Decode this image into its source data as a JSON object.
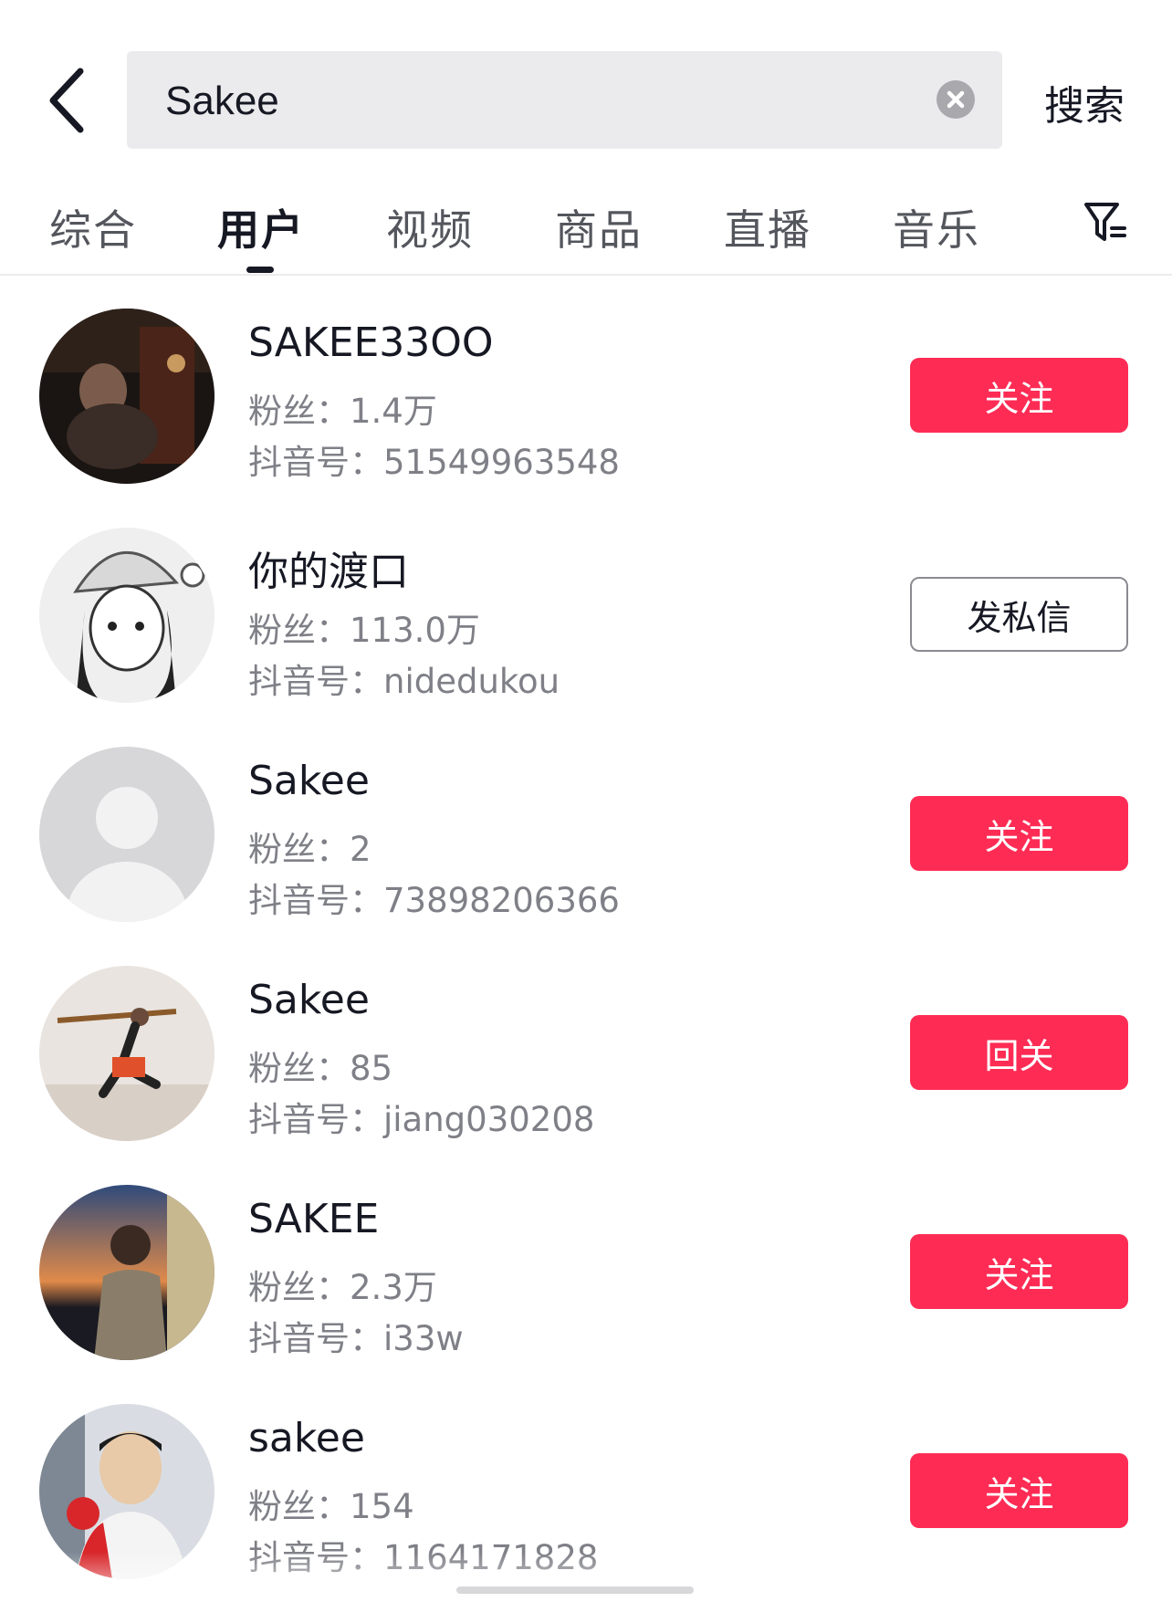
{
  "search": {
    "query": "Sakee",
    "button_label": "搜索"
  },
  "tabs": [
    {
      "label": "综合",
      "active": false
    },
    {
      "label": "用户",
      "active": true
    },
    {
      "label": "视频",
      "active": false
    },
    {
      "label": "商品",
      "active": false
    },
    {
      "label": "直播",
      "active": false
    },
    {
      "label": "音乐",
      "active": false
    }
  ],
  "labels": {
    "fans_prefix": "粉丝：",
    "id_prefix": "抖音号："
  },
  "users": [
    {
      "name": "SAKEE33OO",
      "fans": "1.4万",
      "douyin_id": "51549963548",
      "action": "关注",
      "action_style": "primary"
    },
    {
      "name": "你的渡口",
      "fans": "113.0万",
      "douyin_id": "nidedukou",
      "action": "发私信",
      "action_style": "outline"
    },
    {
      "name": "Sakee",
      "fans": "2",
      "douyin_id": "73898206366",
      "action": "关注",
      "action_style": "primary"
    },
    {
      "name": "Sakee",
      "fans": "85",
      "douyin_id": "jiang030208",
      "action": "回关",
      "action_style": "primary"
    },
    {
      "name": "SAKEE",
      "fans": "2.3万",
      "douyin_id": "i33w",
      "action": "关注",
      "action_style": "primary"
    },
    {
      "name": "sakee",
      "fans": "154",
      "douyin_id": "1164171828",
      "action": "关注",
      "action_style": "primary"
    }
  ],
  "colors": {
    "accent": "#fe2c55",
    "text_primary": "#161823",
    "text_secondary": "#7f8087",
    "search_bg": "#ebebed"
  },
  "icons": {
    "back": "chevron-left-icon",
    "clear": "clear-circle-icon",
    "filter": "filter-icon"
  }
}
